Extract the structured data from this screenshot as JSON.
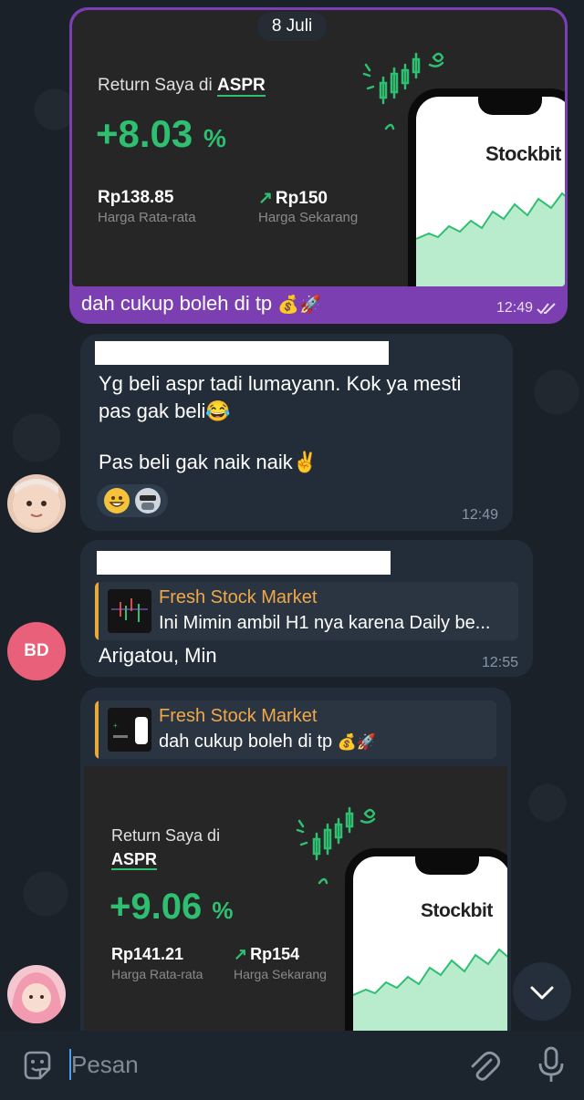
{
  "date_pill": "8 Juli",
  "outgoing": {
    "card": {
      "label_prefix": "Return Saya di",
      "ticker": "ASPR",
      "percent": "+8.03",
      "percent_unit": "%",
      "avg_price": "Rp138.85",
      "avg_price_label": "Harga Rata-rata",
      "current_price": "Rp150",
      "current_price_label": "Harga Sekarang",
      "phone_logo": "Stockbit"
    },
    "caption": "dah cukup boleh di tp",
    "caption_emoji": "💰🚀",
    "time": "12:49"
  },
  "msg1": {
    "line1": "Yg beli aspr tadi lumayann. Kok ya mesti",
    "line2": "pas gak beli😂",
    "line3": "Pas beli gak naik naik✌️",
    "time": "12:49",
    "reactions": [
      "grinning-emoji",
      "sticker-avatar"
    ]
  },
  "msg2": {
    "avatar_initials": "BD",
    "reply_title": "Fresh Stock Market",
    "reply_text": "Ini Mimin ambil H1 nya karena Daily be...",
    "text": "Arigatou, Min",
    "time": "12:55"
  },
  "msg3": {
    "reply_title": "Fresh Stock Market",
    "reply_text": "dah cukup boleh di tp",
    "reply_emoji": "💰🚀",
    "card": {
      "label_prefix": "Return Saya di",
      "ticker": "ASPR",
      "percent": "+9.06",
      "percent_unit": "%",
      "avg_price": "Rp141.21",
      "avg_price_label": "Harga Rata-rata",
      "current_price": "Rp154",
      "current_price_label": "Harga Sekarang",
      "phone_logo": "Stockbit"
    }
  },
  "input": {
    "placeholder": "Pesan"
  },
  "colors": {
    "accent_green": "#2fbf71",
    "outgoing_bubble": "#7b3fb1",
    "incoming_bubble": "#232d39",
    "reply_accent": "#f0a84a"
  }
}
